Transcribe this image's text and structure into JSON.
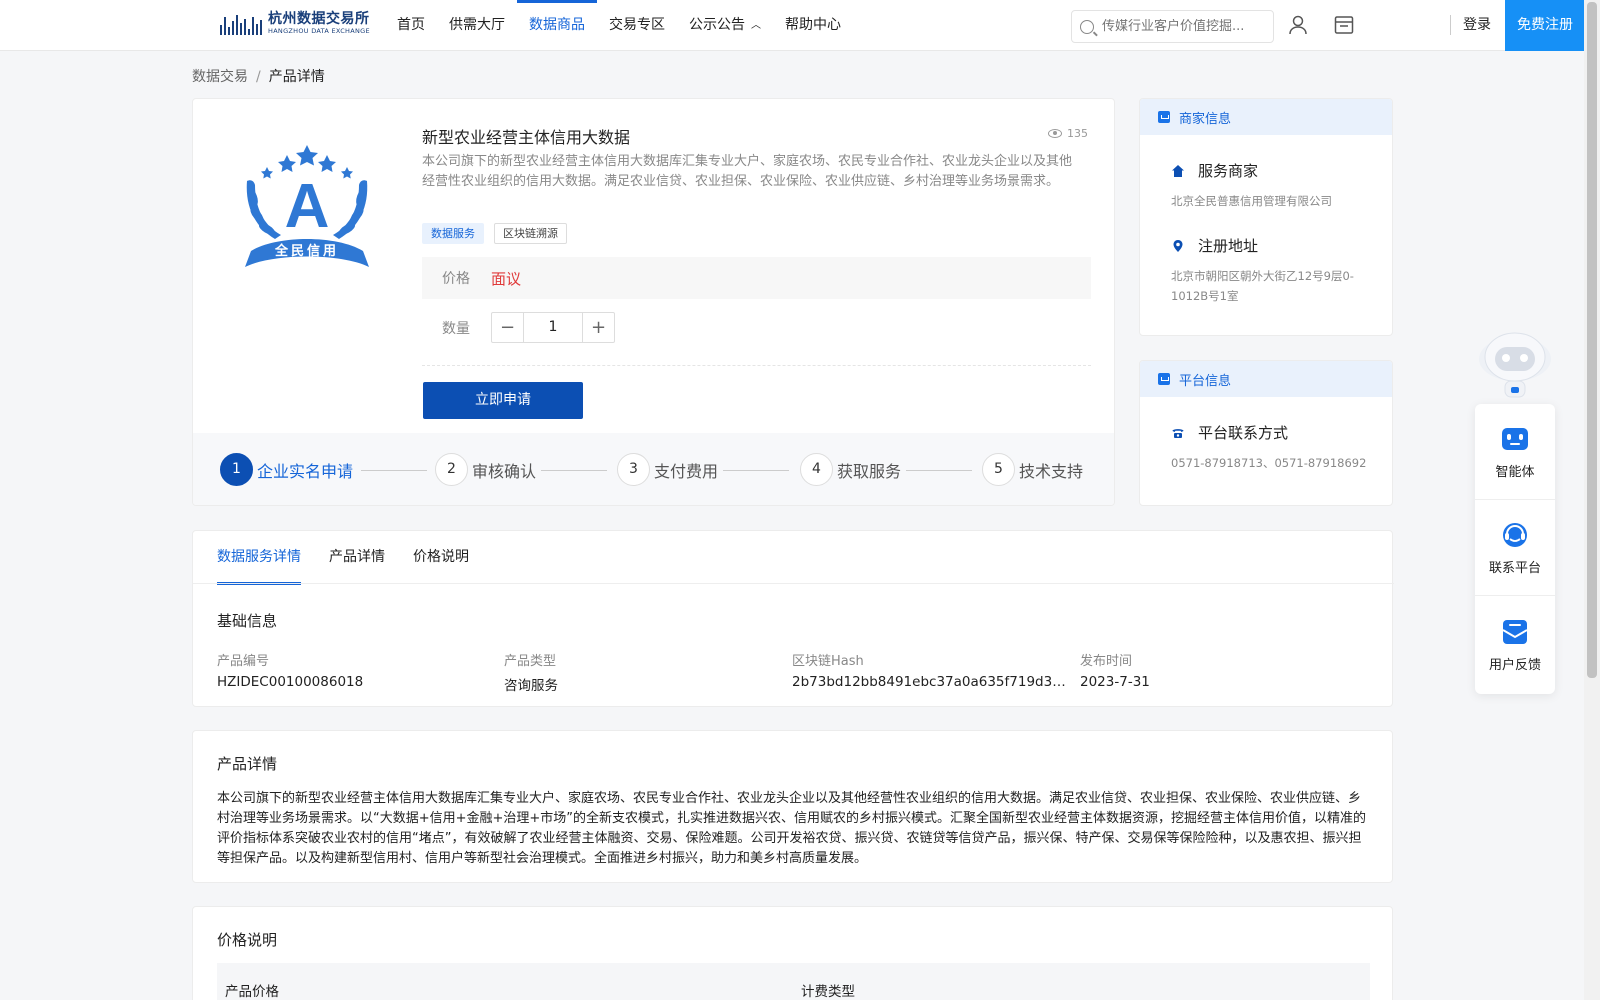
{
  "header": {
    "logo_cn": "杭州数据交易所",
    "logo_en": "HANGZHOU DATA EXCHANGE",
    "nav": [
      {
        "label": "首页"
      },
      {
        "label": "供需大厅"
      },
      {
        "label": "数据商品"
      },
      {
        "label": "交易专区"
      },
      {
        "label": "公示公告"
      },
      {
        "label": "帮助中心"
      }
    ],
    "search_placeholder": "传媒行业客户价值挖掘...",
    "login": "登录",
    "register": "免费注册"
  },
  "breadcrumb": {
    "parent": "数据交易",
    "sep": "/",
    "current": "产品详情"
  },
  "product": {
    "logo_letter": "A",
    "logo_banner": "全民信用",
    "title": "新型农业经营主体信用大数据",
    "views": "135",
    "description": "本公司旗下的新型农业经营主体信用大数据库汇集专业大户、家庭农场、农民专业合作社、农业龙头企业以及其他经营性农业组织的信用大数据。满足农业信贷、农业担保、农业保险、农业供应链、乡村治理等业务场景需求。",
    "tags": [
      "数据服务",
      "区块链溯源"
    ],
    "price_label": "价格",
    "price_value": "面议",
    "qty_label": "数量",
    "qty_value": "1",
    "qty_minus": "−",
    "qty_plus": "+",
    "apply_button": "立即申请"
  },
  "steps": [
    {
      "num": "1",
      "label": "企业实名申请"
    },
    {
      "num": "2",
      "label": "审核确认"
    },
    {
      "num": "3",
      "label": "支付费用"
    },
    {
      "num": "4",
      "label": "获取服务"
    },
    {
      "num": "5",
      "label": "技术支持"
    }
  ],
  "merchant": {
    "header": "商家信息",
    "service_label": "服务商家",
    "service_value": "北京全民普惠信用管理有限公司",
    "address_label": "注册地址",
    "address_value": "北京市朝阳区朝外大街乙12号9层0-1012B号1室"
  },
  "platform": {
    "header": "平台信息",
    "contact_label": "平台联系方式",
    "contact_value": "0571-87918713、0571-87918692"
  },
  "tabs": [
    "数据服务详情",
    "产品详情",
    "价格说明"
  ],
  "basic": {
    "title": "基础信息",
    "fields": [
      {
        "k": "产品编号",
        "v": "HZIDEC00100086018"
      },
      {
        "k": "产品类型",
        "v": "咨询服务"
      },
      {
        "k": "区块链Hash",
        "v": "2b73bd12bb8491ebc37a0a635f719d38be..."
      },
      {
        "k": "发布时间",
        "v": "2023-7-31"
      }
    ]
  },
  "detail": {
    "title": "产品详情",
    "text": "本公司旗下的新型农业经营主体信用大数据库汇集专业大户、家庭农场、农民专业合作社、农业龙头企业以及其他经营性农业组织的信用大数据。满足农业信贷、农业担保、农业保险、农业供应链、乡村治理等业务场景需求。以“大数据+信用+金融+治理+市场”的全新支农模式，扎实推进数据兴农、信用赋农的乡村振兴模式。汇聚全国新型农业经营主体数据资源，挖掘经营主体信用价值，以精准的评价指标体系突破农业农村的信用“堵点”，有效破解了农业经营主体融资、交易、保险难题。公司开发裕农贷、振兴贷、农链贷等信贷产品，振兴保、特产保、交易保等保险险种，以及惠农担、振兴担等担保产品。以及构建新型信用村、信用户等新型社会治理模式。全面推进乡村振兴，助力和美乡村高质量发展。"
  },
  "pricing": {
    "title": "价格说明",
    "col1": "产品价格",
    "col2": "计费类型"
  },
  "float": {
    "items": [
      {
        "label": "智能体"
      },
      {
        "label": "联系平台"
      },
      {
        "label": "用户反馈"
      }
    ]
  },
  "colors": {
    "primary": "#1565d8",
    "button": "#0c4fb3",
    "register": "#1690f6",
    "price": "#e03a3a"
  }
}
